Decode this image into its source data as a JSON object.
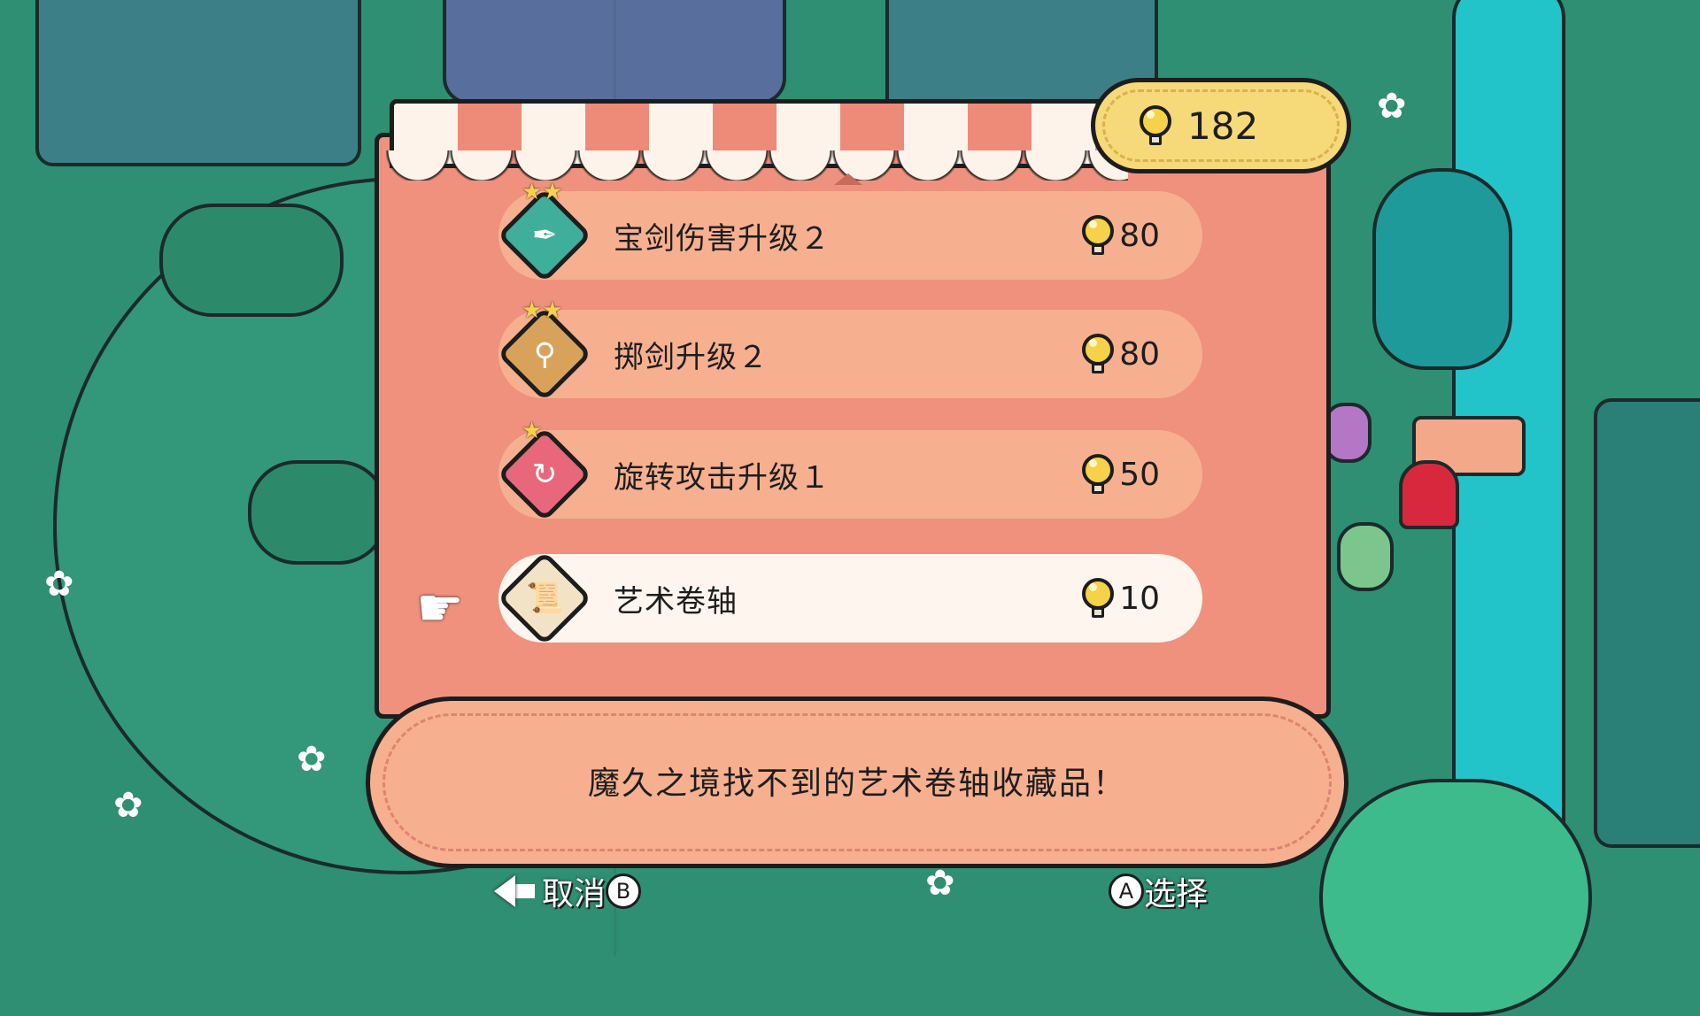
{
  "currency": {
    "icon": "lightbulb-icon",
    "amount": "182"
  },
  "items": [
    {
      "name": "宝剑伤害升级２",
      "price": "80",
      "icon": "sword-damage-icon",
      "stars": "★★",
      "color": "#3fae9a"
    },
    {
      "name": "掷剑升级２",
      "price": "80",
      "icon": "sword-throw-icon",
      "stars": "★★",
      "color": "#d9a25a"
    },
    {
      "name": "旋转攻击升级１",
      "price": "50",
      "icon": "spin-attack-icon",
      "stars": "★",
      "color": "#e8677a"
    },
    {
      "name": "艺术卷轴",
      "price": "10",
      "icon": "art-scroll-icon",
      "stars": "",
      "color": "#f2e3c6"
    }
  ],
  "description": "魔久之境找不到的艺术卷轴收藏品！",
  "controls": {
    "cancel_label": "取消",
    "cancel_key": "B",
    "select_key": "A",
    "select_label": "选择"
  }
}
